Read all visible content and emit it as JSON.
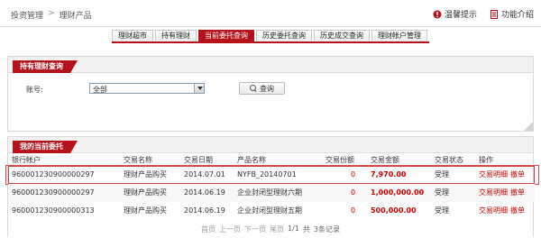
{
  "breadcrumb": {
    "home": "投资管理",
    "sep": ">",
    "current": "理财产品"
  },
  "top_links": {
    "tips": "温馨提示",
    "intro": "功能介绍"
  },
  "tabs": [
    "理财超市",
    "持有理财",
    "当前委托查询",
    "历史委托查询",
    "历史成交查询",
    "理财帐户管理"
  ],
  "active_tab": "当前委托查询",
  "panel1": {
    "title": "持有理财查询",
    "account_label": "账号:",
    "account_value": "全部",
    "query_label": "查询"
  },
  "panel2": {
    "title": "我的当前委托"
  },
  "table": {
    "headers": [
      "银行帐户",
      "交易名称",
      "交易日期",
      "产品名称",
      "交易份额",
      "交易金额",
      "交易状态",
      "操作"
    ],
    "rows": [
      {
        "account": "960001230900000297",
        "name": "理财产品购买",
        "date": "2014.07.01",
        "product": "NYFB_20140701",
        "share": "0",
        "amount": "7,970.00",
        "status": "受理",
        "op1": "交易明细",
        "op2": "撤单"
      },
      {
        "account": "960001230900000297",
        "name": "理财产品购买",
        "date": "2014.06.19",
        "product": "企业封闭型理财六期",
        "share": "0",
        "amount": "1,000,000.00",
        "status": "受理",
        "op1": "交易明细",
        "op2": "撤单"
      },
      {
        "account": "960001230900000313",
        "name": "理财产品购买",
        "date": "2014.06.19",
        "product": "企业封闭型理财五期",
        "share": "0",
        "amount": "500,000.00",
        "status": "受理",
        "op1": "交易明细",
        "op2": "撤单"
      }
    ]
  },
  "pager": {
    "first": "首页",
    "prev": "上一页",
    "next": "下一页",
    "last": "尾页",
    "pages": "1/1",
    "total_pre": "共",
    "total": "3条记录"
  },
  "colors": {
    "accent": "#b5121b",
    "amount": "#cc0000"
  }
}
